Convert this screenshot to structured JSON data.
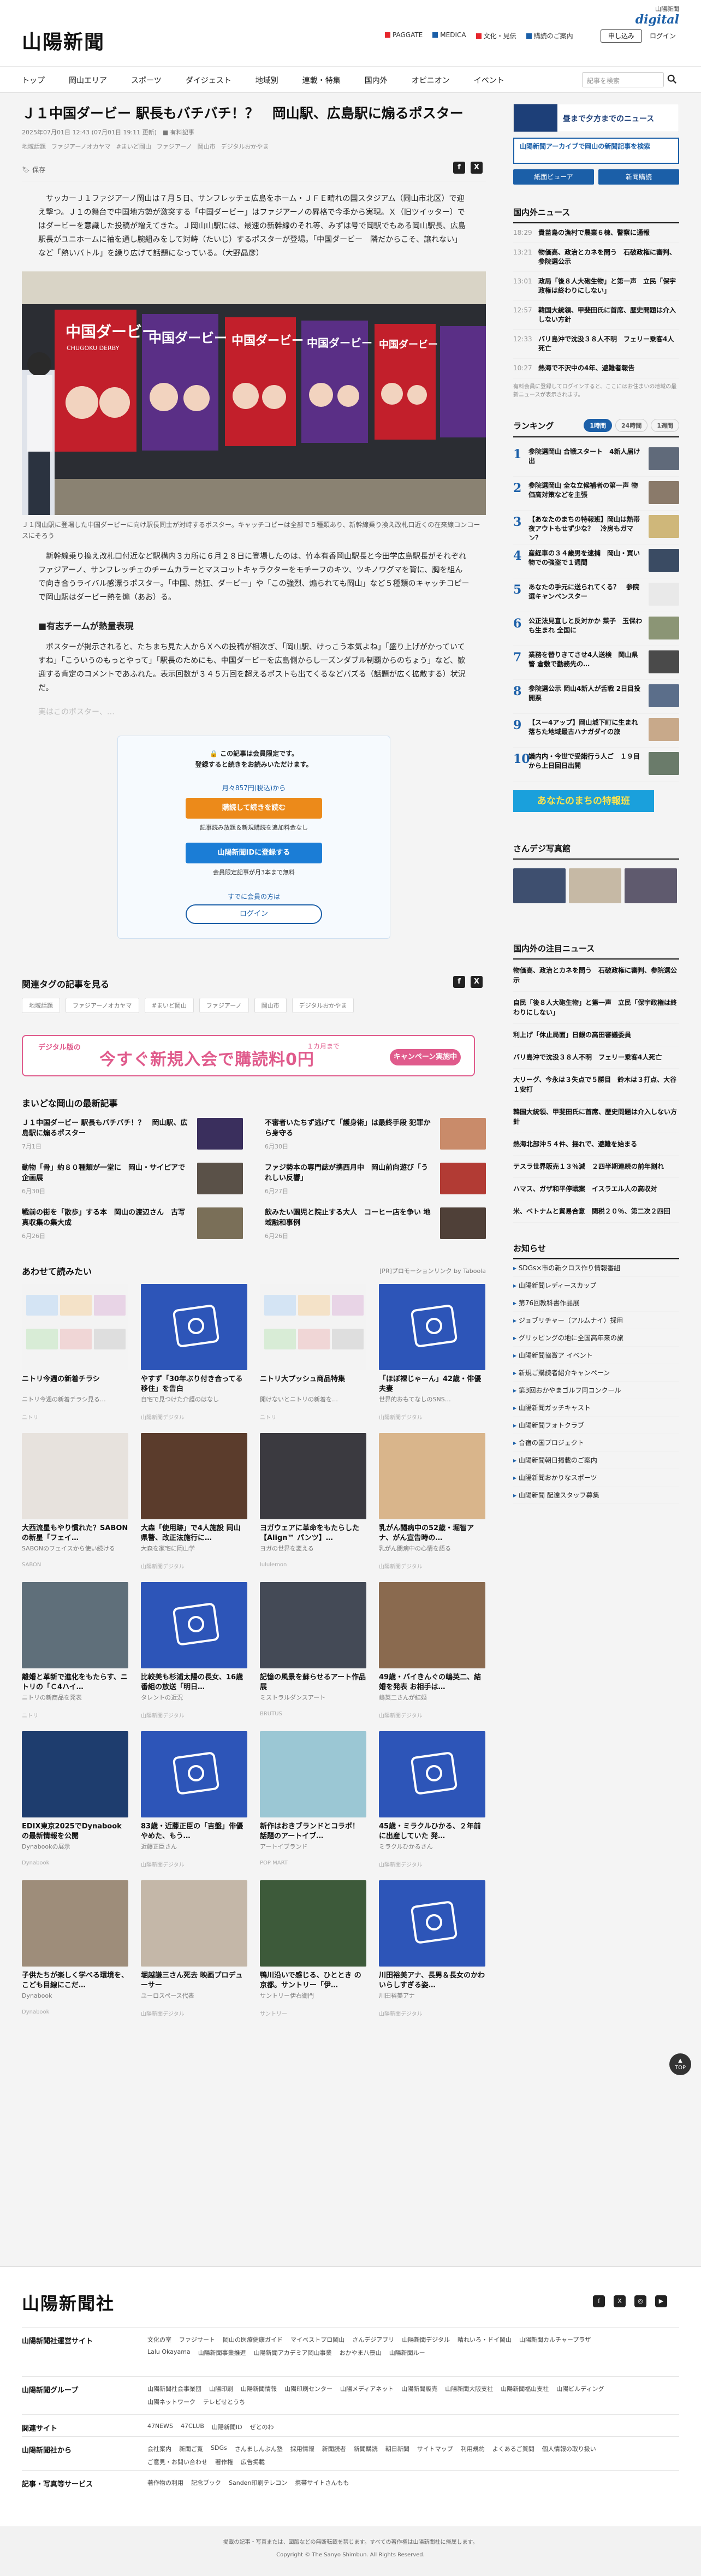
{
  "header": {
    "logo": "山陽新聞",
    "digital_label": "山陽新聞",
    "digital_brand": "digital",
    "links": [
      {
        "label": "PAGGATE",
        "color": "#e6262d"
      },
      {
        "label": "MEDICA",
        "color": "#1b5fa8"
      },
      {
        "label": "文化・見伝",
        "color": "#e6262d"
      },
      {
        "label": "購読のご案内",
        "color": "#1b5fa8"
      }
    ],
    "apply": "申し込み",
    "login": "ログイン",
    "nav": [
      "トップ",
      "岡山エリア",
      "スポーツ",
      "ダイジェスト",
      "地域別",
      "連載・特集",
      "国内外",
      "オピニオン",
      "イベント"
    ],
    "search_placeholder": "記事を検索"
  },
  "article": {
    "title": "Ｊ１中国ダービー 駅長もバチバチ！？　岡山駅、広島駅に煽るポスター",
    "meta": "2025年07月01日 12:43 (07月01日 19:11 更新)　■ 有料記事",
    "tags": [
      "地域話題",
      "ファジアーノオカヤマ",
      "#まいど岡山",
      "ファジアーノ",
      "岡山市",
      "デジタルおかやま"
    ],
    "save": "保存",
    "lead": "サッカーＪ１ファジアーノ岡山は７月５日、サンフレッチェ広島をホーム・ＪＦＥ晴れの国スタジアム（岡山市北区）で迎え撃つ。Ｊ１の舞台で中国地方勢が激突する「中国ダービー」はファジアーノの昇格で今季から実現。Ｘ（旧ツイッター）ではダービーを意識した投稿が増えてきた。Ｊ岡山山駅には、最速の新幹線のそれ等、みずは号で岡駅でもある岡山駅長、広島駅長がユニホームに袖を通し腕組みをして対峙（たいじ）するポスターが登場。「中国ダービー　隣だからこそ、譲れない」など「熱いバトル」を繰り広げて話題になっている。（大野晶彦）",
    "photo_text_left": "中国ダービー",
    "photo_text_sub": "CHUGOKU DERBY",
    "caption": "Ｊ１岡山駅に登場した中国ダービーに向け駅長同士が対峙するポスター。キャッチコピーは全部で５種類あり、新幹線乗り換え改札口近くの在来線コンコースにそろう",
    "body1": "新幹線乗り換え改札口付近など駅構内３カ所に６月２８日に登場したのは、竹本有香岡山駅長と今田学広島駅長がそれぞれファジアーノ、サンフレッチェのチームカラーとマスコットキャラクターをモチーフのキツ、ツキノワグマを背に、胸を組んで向き合うライバル感漂うポスター。「中国、熱狂、ダービー」や「この強烈、煽られても岡山」など５種類のキャッチコピーで岡山駅はダービー熱を煽（あお）る。",
    "subhead": "■有志チームが熱量表現",
    "body2": "ポスターが掲示されると、たちまち見た人からＸへの投稿が相次ぎ、「岡山駅、けっこう本気よね」「盛り上げがかっていてすね」「こういうのもっとやって」「駅長のためにも、中国ダービーを広島側からし一ズンダブル制覇からのちょう」など、歓迎する肯定のコメントであふれた。表示回数が３４５万回を超えるポストも出てくるなどバズる（話題が広く拡散する）状況だ。",
    "fade": "実はこのポスター、…"
  },
  "paywall": {
    "title1": "🔒 この記事は会員限定です。",
    "title2": "登録すると続きをお読みいただけます。",
    "price": "月々857円(税込)から",
    "read_button": "購読して続きを読む",
    "read_note": "記事読み放題＆新規購読を追加料金なし",
    "register_button": "山陽新聞IDに登録する",
    "register_note": "会員限定記事が月3本まで無料",
    "member_link": "すでに会員の方は",
    "login_button": "ログイン"
  },
  "related": {
    "heading": "関連タグの記事を見る",
    "tags": [
      "地域話題",
      "ファジアーノオカヤマ",
      "#まいど岡山",
      "ファジアーノ",
      "岡山市",
      "デジタルおかやま"
    ]
  },
  "banner": {
    "small": "デジタル版の",
    "main": "今すぐ新規入会で購読料0円",
    "note": "１カ月まで",
    "cta": "キャンペーン実施中"
  },
  "local": {
    "heading": "まいどな岡山の最新記事",
    "items": [
      {
        "title": "Ｊ１中国ダービー 駅長もバチバチ！？　岡山駅、広島駅に煽るポスター",
        "date": "7月1日",
        "color": "#3a2f5d"
      },
      {
        "title": "不審者いたちず逃げて「護身術」は最終手段 犯罪から身守る",
        "date": "6月30日",
        "color": "#c98b6a"
      },
      {
        "title": "動物「骨」約８０種類が一堂に　岡山・サイピアで企画展",
        "date": "6月30日",
        "color": "#5a5148"
      },
      {
        "title": "ファジ勢本の専門誌が携西月中　岡山前向遊び「うれしい反響」",
        "date": "6月27日",
        "color": "#b23b34"
      },
      {
        "title": "戦前の街を「散歩」する本　岡山の渡辺さん　古写真収集の集大成",
        "date": "6月26日",
        "color": "#7a6f58"
      },
      {
        "title": "飲みたい園児と院止する大人　コーヒー店を争い 地域融和事例",
        "date": "6月26日",
        "color": "#4f4038"
      }
    ]
  },
  "recommended": {
    "heading": "あわせて読みたい",
    "pr": "[PR]プロモーションリンク by Taboola",
    "items": [
      {
        "title": "ニトリ今週の新着チラシ",
        "desc": "ニトリ今週の新着チラシ見る…",
        "src": "ニトリ",
        "kind": "flyer",
        "color": "#f3f3f3"
      },
      {
        "title": "やすず「30年ぶり付き合ってる移住」を告白",
        "desc": "自宅で見つけた介護のはなし",
        "src": "山陽新聞デジタル",
        "kind": "ph",
        "color": "#2d55b8"
      },
      {
        "title": "ニトリ大プッシュ商品特集",
        "desc": "開けないとニトリの新着を…",
        "src": "ニトリ",
        "kind": "flyer",
        "color": "#f3f3f3"
      },
      {
        "title": "「ほぼ裸じゃーん」42歳・俳優夫妻",
        "desc": "世界的おもてなしのSNS…",
        "src": "山陽新聞デジタル",
        "kind": "ph",
        "color": "#2d55b8"
      },
      {
        "title": "大西流星もやり慣れた？SABONの新星「フェイ…",
        "desc": "SABONのフェイスから使い続ける",
        "src": "SABON",
        "kind": "photo",
        "color": "#e7e2dd"
      },
      {
        "title": "大森「使用跡」で4人施設 同山県警、改正法施行に…",
        "desc": "大森を家宅に岡山学",
        "src": "山陽新聞デジタル",
        "kind": "photo",
        "color": "#5b3c2c"
      },
      {
        "title": "ヨガウェアに革命をもたらした【Align™ パンツ】…",
        "desc": "ヨガの世界を変える",
        "src": "lululemon",
        "kind": "photo",
        "color": "#3b3a40"
      },
      {
        "title": "乳がん闘病中の52歳・堀智アナ、がん宣告時の…",
        "desc": "乳がん闘病中の心情を語る",
        "src": "山陽新聞デジタル",
        "kind": "photo",
        "color": "#d9b58b"
      },
      {
        "title": "離婚と革新で進化をもたらす、ニトリの「Ｃ4ハイ…",
        "desc": "ニトリの新商品を発表",
        "src": "ニトリ",
        "kind": "photo",
        "color": "#5f6f7a"
      },
      {
        "title": "比較美も杉浦太陽の長女、16歳番組の放送「明日…",
        "desc": "タレントの近況",
        "src": "山陽新聞デジタル",
        "kind": "ph",
        "color": "#2d55b8"
      },
      {
        "title": "記憶の風景を蘇らせるアート作品展",
        "desc": "ミストラルダンスアート",
        "src": "BRUTUS",
        "kind": "photo",
        "color": "#444a56"
      },
      {
        "title": "49歳・バイきんぐの嶋英二、結婚を発表 お相手は…",
        "desc": "嶋英二さんが結婚",
        "src": "山陽新聞デジタル",
        "kind": "photo",
        "color": "#8a6a4f"
      },
      {
        "title": "EDIX東京2025でDynabookの最新情報を公開",
        "desc": "Dynabookの展示",
        "src": "Dynabook",
        "kind": "photo",
        "color": "#1e3d6e"
      },
      {
        "title": "83歳・近藤正臣の「吉盤」俳優やめた、もう…",
        "desc": "近藤正臣さん",
        "src": "山陽新聞デジタル",
        "kind": "ph",
        "color": "#2d55b8"
      },
      {
        "title": "新作はおきブランドとコラボ！ 話題のアートイブ…",
        "desc": "アートイブランド",
        "src": "POP MART",
        "kind": "photo",
        "color": "#9bc7d4"
      },
      {
        "title": "45歳・ミラクルひかる、２年前に出産していた 発…",
        "desc": "ミラクルひかるさん",
        "src": "山陽新聞デジタル",
        "kind": "ph",
        "color": "#2d55b8"
      },
      {
        "title": "子供たちが楽しく学べる環境を、こども目線にこだ…",
        "desc": "Dynabook",
        "src": "Dynabook",
        "kind": "photo",
        "color": "#9e8d7a"
      },
      {
        "title": "堀越謙三さん死去 映画プロデューサー",
        "desc": "ユーロスペース代表",
        "src": "山陽新聞デジタル",
        "kind": "photo",
        "color": "#c4b7a8"
      },
      {
        "title": "鴨川沿いで感じる、ひととき の京都。サントリー「伊…",
        "desc": "サントリー伊右衛門",
        "src": "サントリー",
        "kind": "photo",
        "color": "#3d5a3a"
      },
      {
        "title": "川田裕美アナ、長男＆長女のかわいらしすぎる姿…",
        "desc": "川田裕美アナ",
        "src": "山陽新聞デジタル",
        "kind": "ph",
        "color": "#2d55b8"
      }
    ]
  },
  "sidebar": {
    "ad1": "昼まで夕方までのニュース",
    "ad2": "山陽新聞アーカイブで岡山の新聞記事を検索",
    "buttons": [
      "紙面ビューア",
      "新聞購読"
    ],
    "national_heading": "国内外ニュース",
    "national": [
      {
        "time": "18:29",
        "text": "貴苗島の漁村で農業６棟、警察に通報",
        "bold": true
      },
      {
        "time": "13:21",
        "text": "物価高、政治とカネを問う　石破政権に審判、参院選公示",
        "bold": true
      },
      {
        "time": "13:01",
        "text": "政局「後８人大砲生物」と第一声　立民「保宇政権は終わりにしない」",
        "bold": true
      },
      {
        "time": "12:57",
        "text": "韓国大統領、甲斐田氏に首席、歴史問題は介入しない方針",
        "bold": true
      },
      {
        "time": "12:33",
        "text": "バリ島沖で沈没３８人不明　フェリー乗客4人死亡",
        "bold": true
      },
      {
        "time": "10:27",
        "text": "熱海で不沢中の4年、避難者報告",
        "bold": true
      }
    ],
    "national_note": "有料会員に登録してログインすると、ここにはお住まいの地域の最新ニュースが表示されます。",
    "ranking_heading": "ランキング",
    "ranking_tabs": [
      "1時間",
      "24時間",
      "1週間"
    ],
    "ranking": [
      {
        "n": "1",
        "text": "参院選岡山 合戦スタート　4新人届け出",
        "color": "#606a7a"
      },
      {
        "n": "2",
        "text": "参院選岡山 全な立候補者の第一声 物価高対策などを主張",
        "color": "#8a7a6a"
      },
      {
        "n": "3",
        "text": "【あなたのまちの特報班】岡山は熱帯夜アウトもせず少な？　冷房もガマン？",
        "color": "#cfb77a"
      },
      {
        "n": "4",
        "text": "産経車の３４歳男を逮捕　岡山・買い物での強盗で１週間",
        "color": "#3a4b63"
      },
      {
        "n": "5",
        "text": "あなたの手元に送られてくる？　参院選キャンペンスター",
        "color": "#e9e9e9"
      },
      {
        "n": "6",
        "text": "公正法見直しと反対かか 菜子　玉保わも生まれ 全国に",
        "color": "#8b9575"
      },
      {
        "n": "7",
        "text": "業務を替りきてさせ4人送検　岡山県警 倉敷で勤務先の…",
        "color": "#4a4a4a"
      },
      {
        "n": "8",
        "text": "参院選公示 岡山4新人が舌戦 2日目投開票",
        "color": "#5b6e8a"
      },
      {
        "n": "9",
        "text": "【スー4アップ】岡山城下町に生まれ落ちた地域最古ハナガダイの旅",
        "color": "#c8a98a"
      },
      {
        "n": "10",
        "text": "議内内・今世で受諾行う人ご　１９目から上日回日出開",
        "color": "#6a7b6a"
      }
    ],
    "special": "あなたのまちの特報班",
    "gallery_heading": "さんデジ写真館",
    "gallery_colors": [
      "#3e4f6f",
      "#c6b9a5",
      "#5f5a6e"
    ],
    "attn_heading": "国内外の注目ニュース",
    "attn": [
      "物価高、政治とカネを問う　石破政権に審判、参院選公示",
      "自民「後８人大砲生物」と第一声　立民「保宇政権は終わりにしない」",
      "利上げ「休止局面」日銀の高田審議委員",
      "バリ島沖で沈没３８人不明　フェリー乗客4人死亡",
      "大リーグ、今永は３失点で５勝目　鈴木は３打点、大谷１安打",
      "韓国大統領、甲斐田氏に首席、歴史問題は介入しない方針",
      "熱海北部沖５４件、揺れで、避難を始まる",
      "テスラ世界販売１３％減　２四半期連続の前年割れ",
      "ハマス、ガザ和平停戦案　イスラエル人の高収対",
      "米、ベトナムと貿易合意　関税２０％、第二次２四回"
    ],
    "notice_heading": "お知らせ",
    "notices": [
      "SDGs×市の新クロス作り情報番組",
      "山陽新聞レディースカップ",
      "第76回教科書作品展",
      "ジョブリチャー（アルムナイ）採用",
      "グリッピングの地に全国高年来の旅",
      "山陽新聞協賞ア イベント",
      "新規ご購読者紹介キャンペーン",
      "第3回おかやまゴルフ同コンクール",
      "山陽新聞ガッチキャスト",
      "山陽新聞フォトクラブ",
      "合宿の国プロジェクト",
      "山陽新聞朝日掲載のご案内",
      "山陽新聞おかりなスポーツ",
      "山陽新聞 配達スタッフ募集"
    ]
  },
  "top_button": "TOP",
  "footer": {
    "logo": "山陽新聞社",
    "sns": [
      "f",
      "X",
      "◎",
      "▶"
    ],
    "rows": [
      {
        "head": "山陽新聞社運営サイト",
        "links": [
          "文化の室",
          "ファジサート",
          "岡山の医療健康ガイド",
          "マイベストプロ岡山",
          "さんデジアプリ",
          "山陽新聞デジタル",
          "晴れいろ・ドイ岡山",
          "山陽新聞カルチャープラザ",
          "Lalu Okayama",
          "山陽新聞事業推進",
          "山陽新聞アカデミア岡山事業",
          "おかやま八景山",
          "山陽新聞ルー"
        ]
      },
      {
        "head": "山陽新聞グループ",
        "links": [
          "山陽新聞社会事業団",
          "山陽印刷",
          "山陽新聞情報",
          "山陽印刷センター",
          "山陽メディアネット",
          "山陽新聞販売",
          "山陽新聞大阪支社",
          "山陽新聞福山支社",
          "山陽ビルディング",
          "山陽ネットワーク",
          "テレビせとうち"
        ]
      },
      {
        "head": "関連サイト",
        "links": [
          "47NEWS",
          "47CLUB",
          "山陽新聞ID",
          "ぜとのわ"
        ]
      },
      {
        "head": "山陽新聞社から",
        "links": [
          "会社案内",
          "新聞ご覧",
          "SDGs",
          "さんましんぶん塾",
          "採用情報",
          "新聞読者",
          "新聞購読",
          "朝日新聞",
          "サイトマップ",
          "利用規約",
          "よくあるご質問",
          "個人情報の取り扱い",
          "ご意見・お問い合わせ",
          "著作権",
          "広告掲載"
        ]
      },
      {
        "head": "記事・写真等サービス",
        "links": [
          "著作物の利用",
          "記念ブック",
          "Sanden印刷テレコン",
          "携帯サイトさんもも"
        ]
      }
    ],
    "bottom1": "掲載の記事・写真または、図版などの無断転載を禁じます。すべての著作権は山陽新聞社に帰属します。",
    "copyright": "Copyright © The Sanyo Shimbun. All Rights Reserved."
  }
}
